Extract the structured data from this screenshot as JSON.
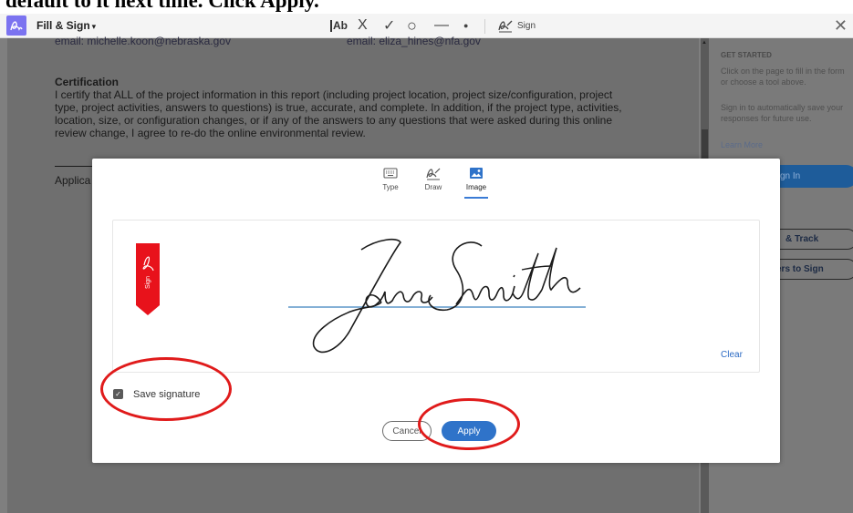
{
  "instruction": {
    "text": "default to it next time. Click Apply."
  },
  "toolbar": {
    "title": "Fill & Sign",
    "caret": "▾",
    "tools": {
      "text_tool": "Ab",
      "cross_tool": "X",
      "check_tool": "✓",
      "circle_tool": "○",
      "line_tool": "—",
      "dot_tool": "●"
    },
    "sign_label": "Sign",
    "close": "✕"
  },
  "document": {
    "email_left": "email: michelle.koon@nebraska.gov",
    "email_right": "email: eliza_hines@nfa.gov",
    "section_heading": "Certification",
    "paragraph_lines": [
      "I certify that ALL of the project information in this report (including project location, project size/configuration, project",
      "type, project activities, answers to questions) is true, accurate, and complete.  In addition, if the project type, activities,",
      "location, size, or configuration changes, or if any of the answers to any questions that were asked during this online",
      "review change, I agree to re-do the online environmental review."
    ],
    "applicant_label": "Applica"
  },
  "right_panel": {
    "heading": "GET STARTED",
    "text_1": "Click on the page to fill in the form or choose a tool above.",
    "text_2": "Sign in to automatically save your responses for future use.",
    "learn_more": "Learn More",
    "sign_in_button": "gn In",
    "track_button": "& Track",
    "send_button": "ers to Sign"
  },
  "modal": {
    "tabs": [
      {
        "label": "Type",
        "icon": "keyboard-icon"
      },
      {
        "label": "Draw",
        "icon": "pen-draw-icon"
      },
      {
        "label": "Image",
        "icon": "image-icon",
        "active": true
      }
    ],
    "signature_text": "Jane Smith",
    "sign_ribbon_text": "Sign",
    "clear_label": "Clear",
    "save_signature_label": "Save signature",
    "save_signature_checked": true,
    "cancel_label": "Cancel",
    "apply_label": "Apply"
  },
  "colors": {
    "accent": "#2f73c9",
    "annotation": "#e01b1b",
    "ribbon": "#e8121b",
    "app_icon": "#7b73f0"
  }
}
